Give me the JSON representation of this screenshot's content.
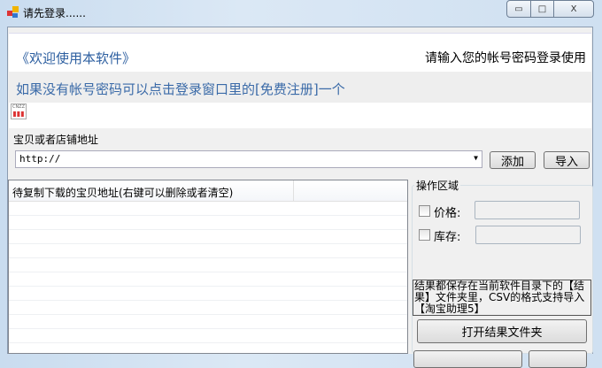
{
  "window": {
    "title": "请先登录......",
    "minimize": "▭",
    "maximize": "□",
    "close": "X"
  },
  "banner": {
    "welcome": "《欢迎使用本软件》",
    "prompt": "请输入您的帐号密码登录使用",
    "hint": "如果没有帐号密码可以点击登录窗口里的[免费注册]一个",
    "cnzz": "CNZZ"
  },
  "address": {
    "label": "宝贝或者店铺地址",
    "value": "http://",
    "add": "添加",
    "import": "导入"
  },
  "list": {
    "header": "待复制下载的宝贝地址(右键可以删除或者清空)",
    "header2": ""
  },
  "ops": {
    "title": "操作区域",
    "price_label": "价格:",
    "stock_label": "库存:",
    "note": "结果都保存在当前软件目录下的【结果】文件夹里，CSV的格式支持导入【淘宝助理5】",
    "open_folder": "打开结果文件夹"
  }
}
